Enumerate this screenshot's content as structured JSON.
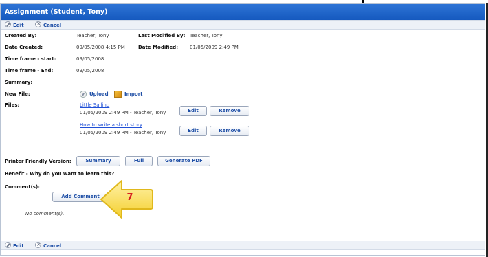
{
  "window": {
    "title": "Assignment (Student, Tony)"
  },
  "toolbar": {
    "edit_label": "Edit",
    "cancel_label": "Cancel"
  },
  "fields": {
    "created_by_label": "Created By:",
    "created_by_value": "Teacher, Tony",
    "last_modified_by_label": "Last Modified By:",
    "last_modified_by_value": "Teacher, Tony",
    "date_created_label": "Date Created:",
    "date_created_value": "09/05/2008 4:15 PM",
    "date_modified_label": "Date Modified:",
    "date_modified_value": "01/05/2009 2:49 PM",
    "timeframe_start_label": "Time frame - start:",
    "timeframe_start_value": "09/05/2008",
    "timeframe_end_label": "Time frame - End:",
    "timeframe_end_value": "09/05/2008",
    "summary_label": "Summary:",
    "new_file_label": "New File:",
    "upload_label": "Upload",
    "import_label": "Import",
    "files_label": "Files:"
  },
  "files": [
    {
      "name": "Little Sailing",
      "meta": "01/05/2009 2:49 PM - Teacher, Tony",
      "edit_label": "Edit",
      "remove_label": "Remove"
    },
    {
      "name": "How to write a short story",
      "meta": "01/05/2009 2:49 PM - Teacher, Tony",
      "edit_label": "Edit",
      "remove_label": "Remove"
    }
  ],
  "printer": {
    "label": "Printer Friendly Version:",
    "summary_label": "Summary",
    "full_label": "Full",
    "pdf_label": "Generate PDF"
  },
  "benefit": {
    "label": "Benefit - Why do you want to learn this?"
  },
  "comments": {
    "label": "Comment(s):",
    "add_label": "Add Comment",
    "empty_text": "No comment(s)."
  },
  "callout": {
    "number": "7",
    "color": "#f6d640",
    "text_color": "#d62020"
  },
  "colors": {
    "title_bar": "#1f63cb",
    "link": "#1f4fd6",
    "toolbar_bg": "#edf1f7"
  },
  "icons": [
    "pencil-icon",
    "cancel-icon",
    "upload-icon",
    "import-icon"
  ]
}
